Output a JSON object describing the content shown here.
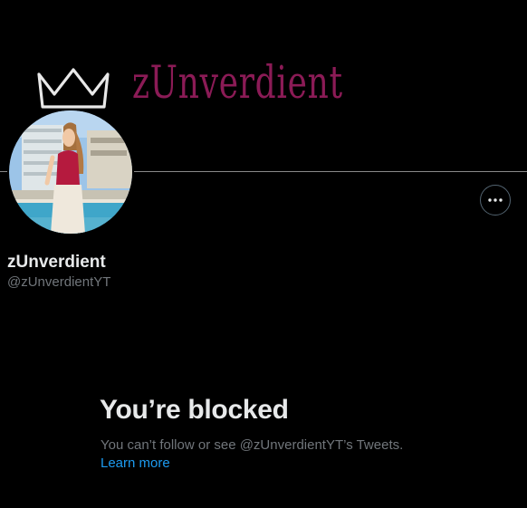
{
  "banner": {
    "title": "zUnverdient",
    "logo_icon": "crown-icon",
    "title_color": "#8b1b56"
  },
  "profile": {
    "display_name": "zUnverdient",
    "handle": "@zUnverdientYT",
    "avatar_icon": "avatar-photo"
  },
  "actions": {
    "more_icon": "more-options-icon"
  },
  "blocked": {
    "title": "You’re blocked",
    "description": "You can’t follow or see @zUnverdientYT’s Tweets.",
    "learn_more": "Learn more"
  },
  "colors": {
    "background": "#000000",
    "primary_text": "#e7e9ea",
    "secondary_text": "#71767b",
    "link": "#1d9bf0",
    "border": "#536471"
  }
}
